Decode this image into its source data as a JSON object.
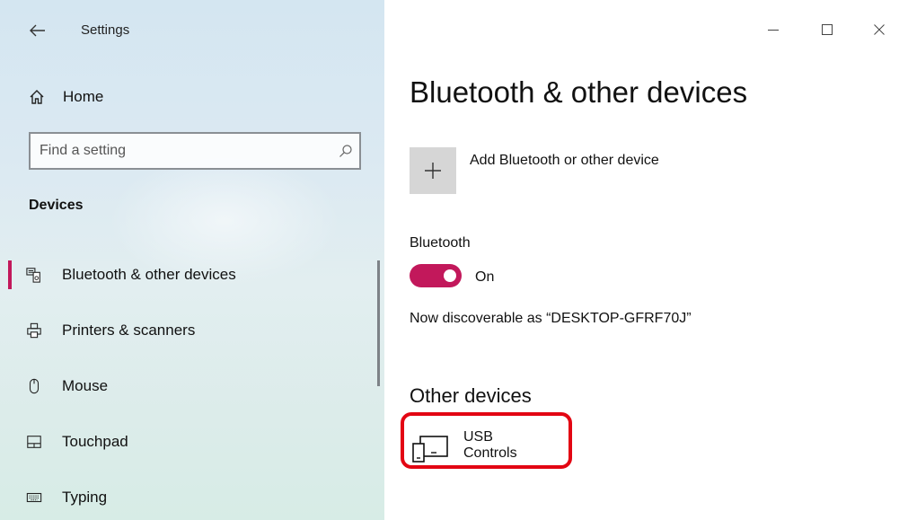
{
  "window": {
    "title": "Settings",
    "controls": {
      "minimize": "—",
      "maximize": "☐",
      "close": "✕"
    }
  },
  "sidebar": {
    "home_label": "Home",
    "search": {
      "placeholder": "Find a setting",
      "value": ""
    },
    "section_heading": "Devices",
    "items": [
      {
        "label": "Bluetooth & other devices",
        "icon": "bluetooth-devices-icon",
        "selected": true
      },
      {
        "label": "Printers & scanners",
        "icon": "printer-icon",
        "selected": false
      },
      {
        "label": "Mouse",
        "icon": "mouse-icon",
        "selected": false
      },
      {
        "label": "Touchpad",
        "icon": "touchpad-icon",
        "selected": false
      },
      {
        "label": "Typing",
        "icon": "keyboard-icon",
        "selected": false
      }
    ]
  },
  "main": {
    "page_title": "Bluetooth & other devices",
    "add_device_label": "Add Bluetooth or other device",
    "bluetooth_label": "Bluetooth",
    "bluetooth_state": "On",
    "discoverable_text": "Now discoverable as “DESKTOP-GFRF70J”",
    "other_devices_heading": "Other devices",
    "devices": [
      {
        "name": "USB Controls",
        "icon": "generic-device-icon"
      }
    ]
  },
  "colors": {
    "accent": "#c2185b",
    "highlight_annotation": "#e30613",
    "sidebar_bg": "#dbe9f2"
  }
}
